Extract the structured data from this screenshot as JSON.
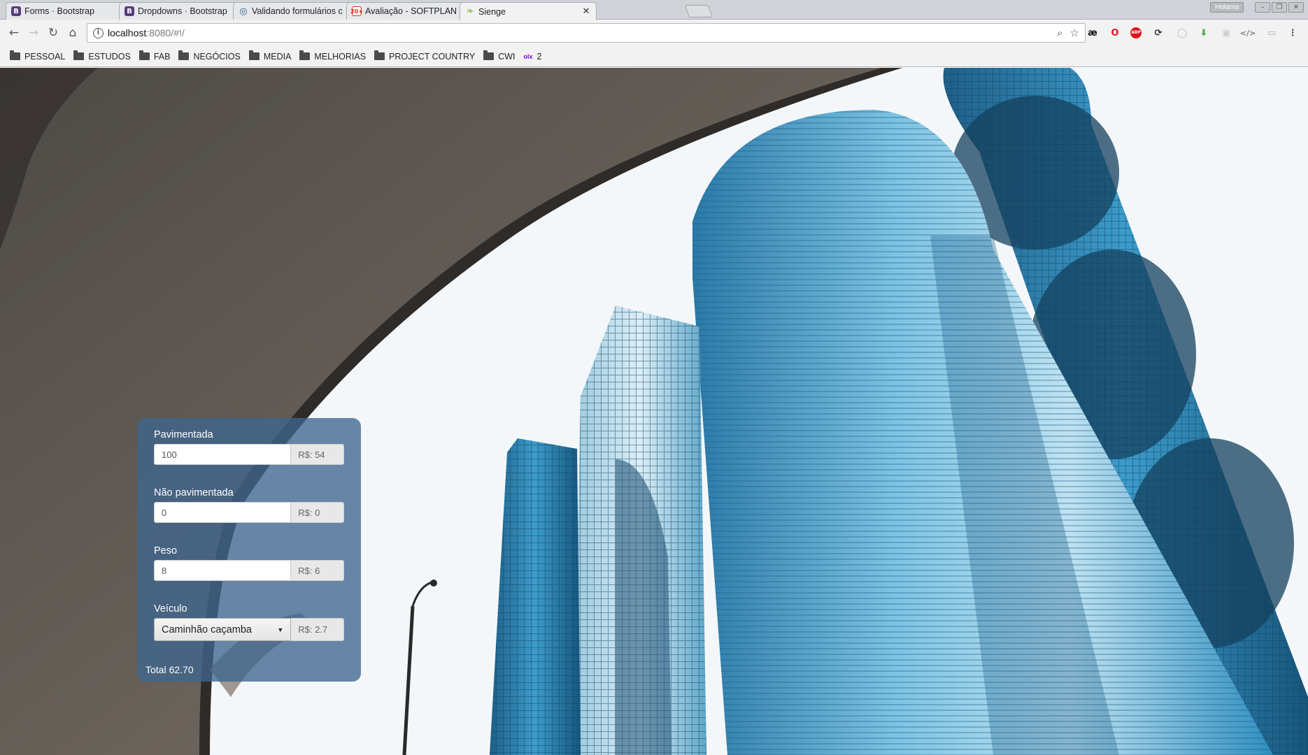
{
  "browser": {
    "tabs": [
      {
        "title": "Forms · Bootstrap",
        "favicon": "B",
        "favicon_color": "#563d7c"
      },
      {
        "title": "Dropdowns · Bootstrap",
        "favicon": "B",
        "favicon_color": "#563d7c"
      },
      {
        "title": "Validando formulários c",
        "favicon": "◎",
        "favicon_color": "#2a5d8c"
      },
      {
        "title": "Avaliação - SOFTPLAN -",
        "favicon": "20+",
        "favicon_color": "#d93025"
      },
      {
        "title": "Sienge",
        "favicon": "❧",
        "favicon_color": "#8bc34a"
      }
    ],
    "profile_name": "Holama",
    "address": {
      "host": "localhost",
      "path": ":8080/#!/"
    },
    "bookmarks": [
      {
        "label": "PESSOAL",
        "icon": "folder-icon"
      },
      {
        "label": "ESTUDOS",
        "icon": "folder-icon"
      },
      {
        "label": "FAB",
        "icon": "folder-icon"
      },
      {
        "label": "NEGÓCIOS",
        "icon": "folder-icon"
      },
      {
        "label": "MEDIA",
        "icon": "folder-icon"
      },
      {
        "label": "MELHORIAS",
        "icon": "folder-icon"
      },
      {
        "label": "PROJECT COUNTRY",
        "icon": "folder-icon"
      },
      {
        "label": "CWI",
        "icon": "folder-icon"
      },
      {
        "label": "2",
        "icon": "olx-icon"
      }
    ]
  },
  "form": {
    "pavimentada": {
      "label": "Pavimentada",
      "value": "100",
      "price": "R$: 54"
    },
    "nao_pavimentada": {
      "label": "Não pavimentada",
      "value": "0",
      "price": "R$: 0"
    },
    "peso": {
      "label": "Peso",
      "value": "8",
      "price": "R$: 6"
    },
    "veiculo": {
      "label": "Veículo",
      "selected": "Caminhão caçamba",
      "price": "R$: 2.7"
    },
    "total_label": "Total",
    "total_value": "62.70"
  },
  "colors": {
    "panel": "#3f658e",
    "sky": "#f4f7f9",
    "glass": "#2f8fc1"
  }
}
